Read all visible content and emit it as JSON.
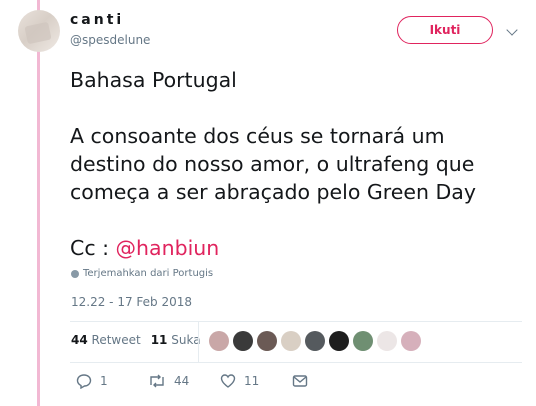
{
  "user": {
    "display_name": "canti",
    "handle": "@spesdelune",
    "follow_label": "Ikuti"
  },
  "tweet": {
    "lines": [
      "Bahasa Portugal",
      "A consoante dos céus se tornará um destino do nosso amor, o ultrafeng que começa a ser abraçado pelo Green Day"
    ],
    "cc_prefix": "Cc : ",
    "mention": "@hanbiun",
    "translate_label": "Terjemahkan dari Portugis",
    "timestamp": "12.22 - 17 Feb 2018"
  },
  "stats": {
    "retweets_count": "44",
    "retweets_label": "Retweet",
    "likes_count": "11",
    "likes_label": "Suka",
    "liker_colors": [
      "#c9a7a7",
      "#3a3a3a",
      "#6b5a55",
      "#d9cfc4",
      "#555a5e",
      "#1e1e1e",
      "#6f8f72",
      "#ece6e6",
      "#d6b0bb"
    ]
  },
  "actions": {
    "reply_count": "1",
    "retweet_count": "44",
    "like_count": "11",
    "icons": [
      "reply-icon",
      "retweet-icon",
      "heart-icon",
      "message-icon"
    ]
  },
  "colors": {
    "accent": "#e0245e",
    "thread_line": "#f2b8d3",
    "muted": "#657786"
  }
}
